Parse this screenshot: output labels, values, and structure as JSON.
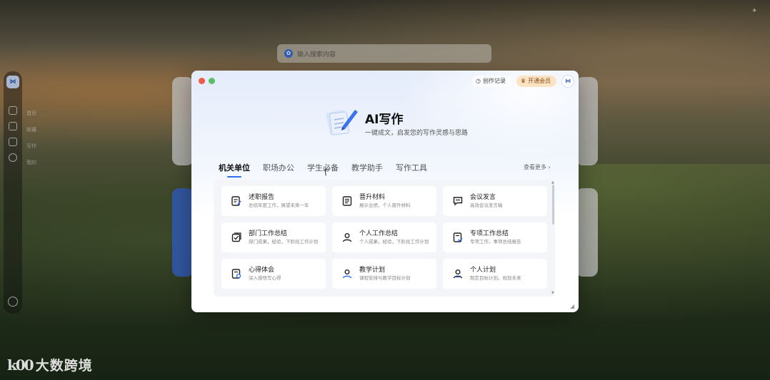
{
  "background": {
    "search_placeholder": "输入搜索内容",
    "dock_labels": [
      "首页",
      "收藏",
      "写作",
      "我的"
    ],
    "watermark": "大数跨境",
    "watermark_mark": "k00"
  },
  "modal": {
    "history_label": "创作记录",
    "vip_label": "开通会员",
    "title": "AI写作",
    "subtitle": "一键成文，启发您的写作灵感与思路",
    "tabs": [
      {
        "label": "机关单位",
        "active": true
      },
      {
        "label": "职场办公",
        "active": false
      },
      {
        "label": "学生必备",
        "active": false
      },
      {
        "label": "教学助手",
        "active": false
      },
      {
        "label": "写作工具",
        "active": false
      }
    ],
    "more_label": "查看更多",
    "cards": [
      {
        "title": "述职报告",
        "desc": "总结年度工作，展望未来一年",
        "icon": "document-edit-icon"
      },
      {
        "title": "晋升材料",
        "desc": "展示业绩，个人晋升材料",
        "icon": "document-list-icon"
      },
      {
        "title": "会议发言",
        "desc": "高效会议发言稿",
        "icon": "speech-bubble-icon"
      },
      {
        "title": "部门工作总结",
        "desc": "部门成果，经验，下阶段工作计划",
        "icon": "checklist-icon"
      },
      {
        "title": "个人工作总结",
        "desc": "个人成果，经验，下阶段工作计划",
        "icon": "person-icon"
      },
      {
        "title": "专项工作总结",
        "desc": "专项工作，事项总结报告",
        "icon": "document-check-icon"
      },
      {
        "title": "心得体会",
        "desc": "深入感悟写心得",
        "icon": "document-person-icon"
      },
      {
        "title": "教学计划",
        "desc": "课程安排与教学目标计划",
        "icon": "teacher-icon"
      },
      {
        "title": "个人计划",
        "desc": "制定目标计划，规划未来",
        "icon": "user-plan-icon"
      }
    ]
  },
  "colors": {
    "accent": "#2f6cf0",
    "vip_bg": "#fbe3c4"
  }
}
